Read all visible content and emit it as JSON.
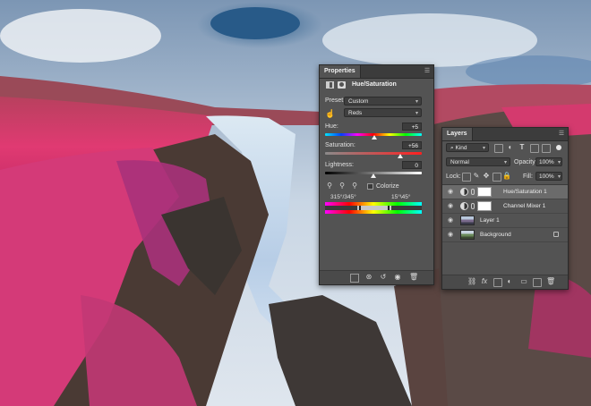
{
  "properties_panel": {
    "tab_label": "Properties",
    "menu_icon": "panel-menu-icon",
    "adjustment_title": "Hue/Saturation",
    "preset_label": "Preset:",
    "preset_value": "Custom",
    "channel_value": "Reds",
    "hue_label": "Hue:",
    "hue_value": "+5",
    "saturation_label": "Saturation:",
    "saturation_value": "+56",
    "lightness_label": "Lightness:",
    "lightness_value": "0",
    "colorize_label": "Colorize",
    "colorize_checked": false,
    "range_left": "315°/345°",
    "range_right": "15°\\45°"
  },
  "layers_panel": {
    "tab_label": "Layers",
    "filter_kind": "Kind",
    "blend_mode": "Normal",
    "opacity_label": "Opacity:",
    "opacity_value": "100%",
    "lock_label": "Lock:",
    "fill_label": "Fill:",
    "fill_value": "100%",
    "layers": [
      {
        "name": "Hue/Saturation 1",
        "type": "adjustment",
        "selected": true
      },
      {
        "name": "Channel Mixer 1",
        "type": "adjustment",
        "selected": false
      },
      {
        "name": "Layer 1",
        "type": "pixel",
        "selected": false
      },
      {
        "name": "Background",
        "type": "background",
        "selected": false,
        "locked": true
      }
    ]
  },
  "colors": {
    "panel_bg": "#535353",
    "tab_bar": "#3c3c3c",
    "selected_layer": "#6b6b6b",
    "infrared_foliage": "#e0306e"
  }
}
